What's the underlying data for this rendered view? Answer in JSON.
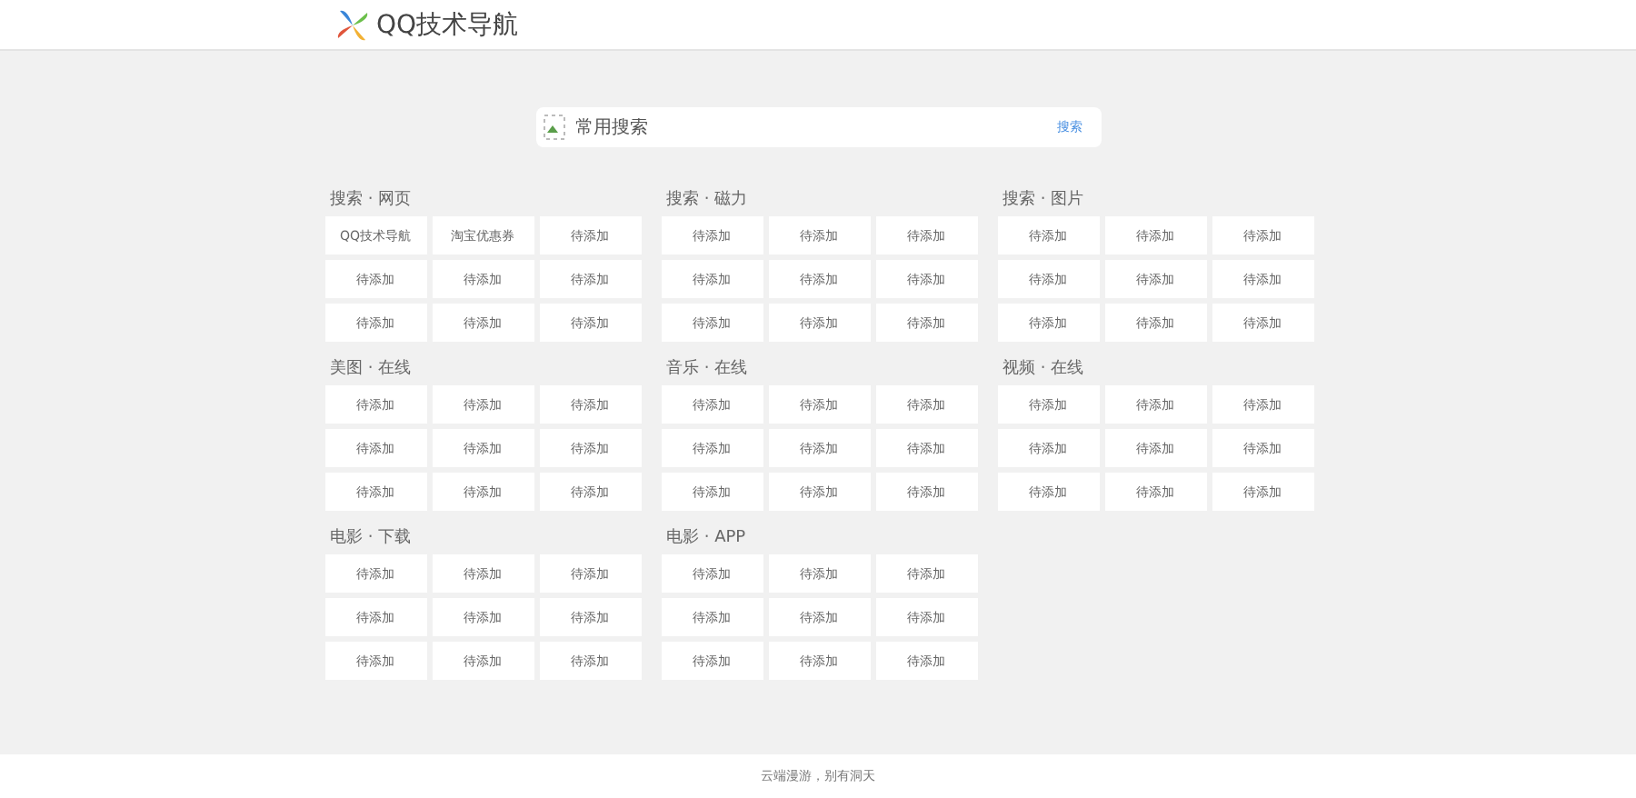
{
  "header": {
    "title": "QQ技术导航"
  },
  "search": {
    "placeholder": "常用搜索",
    "button": "搜索"
  },
  "sections": [
    {
      "title": "搜索 · 网页",
      "links": [
        "QQ技术导航",
        "淘宝优惠券",
        "待添加",
        "待添加",
        "待添加",
        "待添加",
        "待添加",
        "待添加",
        "待添加"
      ]
    },
    {
      "title": "搜索 · 磁力",
      "links": [
        "待添加",
        "待添加",
        "待添加",
        "待添加",
        "待添加",
        "待添加",
        "待添加",
        "待添加",
        "待添加"
      ]
    },
    {
      "title": "搜索 · 图片",
      "links": [
        "待添加",
        "待添加",
        "待添加",
        "待添加",
        "待添加",
        "待添加",
        "待添加",
        "待添加",
        "待添加"
      ]
    },
    {
      "title": "美图 · 在线",
      "links": [
        "待添加",
        "待添加",
        "待添加",
        "待添加",
        "待添加",
        "待添加",
        "待添加",
        "待添加",
        "待添加"
      ]
    },
    {
      "title": "音乐 · 在线",
      "links": [
        "待添加",
        "待添加",
        "待添加",
        "待添加",
        "待添加",
        "待添加",
        "待添加",
        "待添加",
        "待添加"
      ]
    },
    {
      "title": "视频 · 在线",
      "links": [
        "待添加",
        "待添加",
        "待添加",
        "待添加",
        "待添加",
        "待添加",
        "待添加",
        "待添加",
        "待添加"
      ]
    },
    {
      "title": "电影 · 下载",
      "links": [
        "待添加",
        "待添加",
        "待添加",
        "待添加",
        "待添加",
        "待添加",
        "待添加",
        "待添加",
        "待添加"
      ]
    },
    {
      "title": "电影 · APP",
      "links": [
        "待添加",
        "待添加",
        "待添加",
        "待添加",
        "待添加",
        "待添加",
        "待添加",
        "待添加",
        "待添加"
      ]
    }
  ],
  "footer": "云端漫游，别有洞天"
}
